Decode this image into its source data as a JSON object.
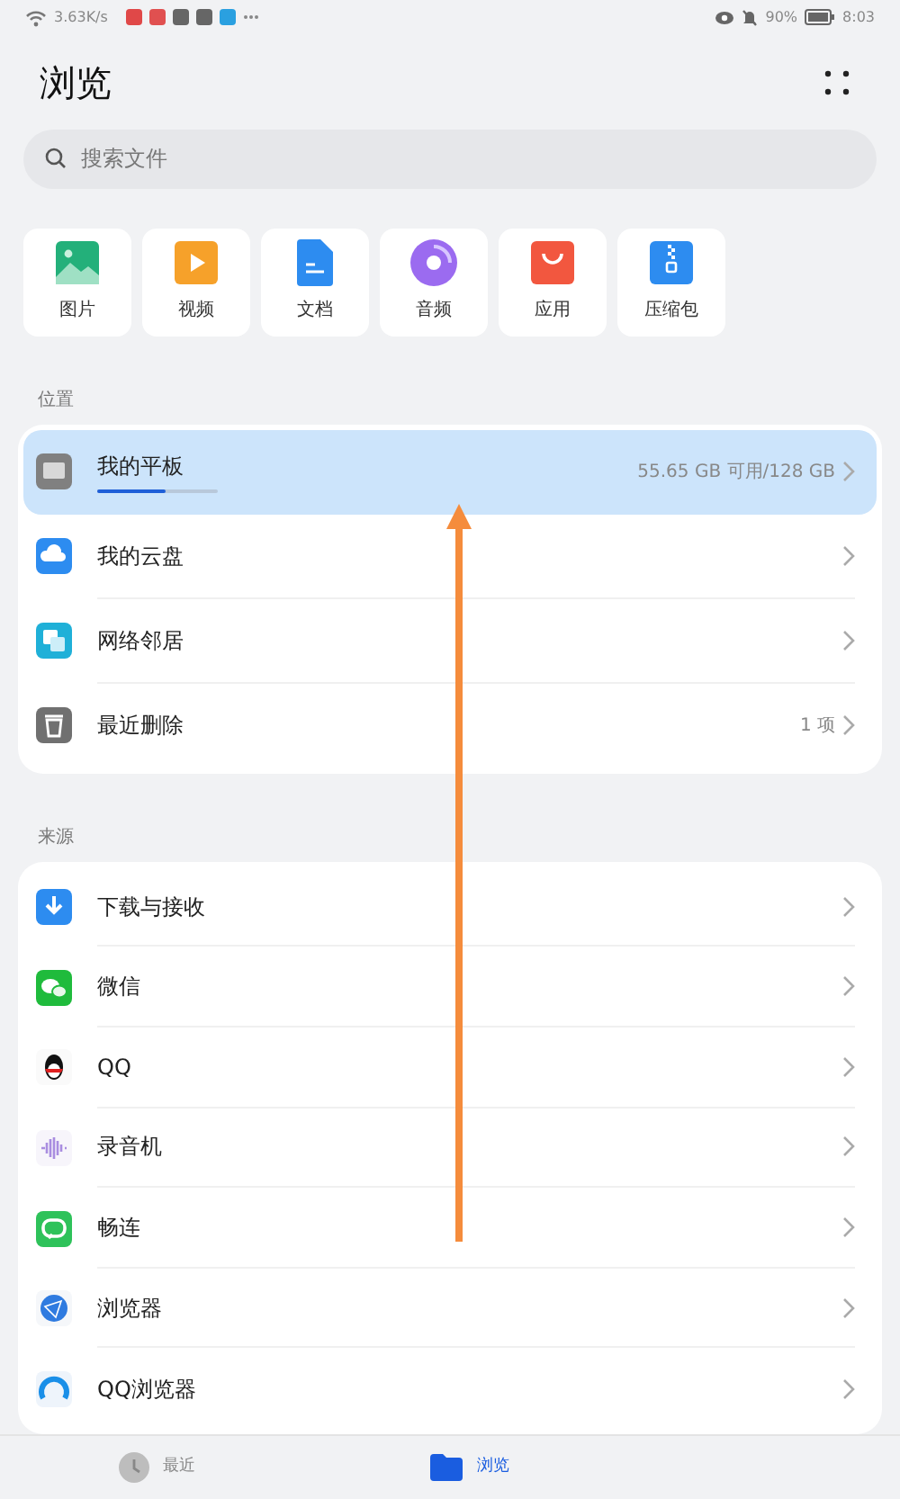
{
  "status_bar": {
    "speed": "3.63K/s",
    "battery": "90%",
    "time": "8:03"
  },
  "title": "浏览",
  "search": {
    "placeholder": "搜索文件"
  },
  "categories": [
    {
      "label": "图片"
    },
    {
      "label": "视频"
    },
    {
      "label": "文档"
    },
    {
      "label": "音频"
    },
    {
      "label": "应用"
    },
    {
      "label": "压缩包"
    }
  ],
  "locations": {
    "heading": "位置",
    "items": [
      {
        "label": "我的平板",
        "detail": "55.65 GB 可用/128 GB",
        "selected": true,
        "level": 0.57
      },
      {
        "label": "我的云盘",
        "selected": false
      },
      {
        "label": "网络邻居",
        "selected": false
      },
      {
        "label": "最近删除",
        "detail": "1 项",
        "selected": false
      }
    ]
  },
  "sources": {
    "heading": "来源",
    "items": [
      {
        "label": "下载与接收"
      },
      {
        "label": "微信"
      },
      {
        "label": "QQ"
      },
      {
        "label": "录音机"
      },
      {
        "label": "畅连"
      },
      {
        "label": "浏览器"
      },
      {
        "label": "QQ浏览器"
      }
    ]
  },
  "bottom_tabs": [
    {
      "label": "最近",
      "selected": false
    },
    {
      "label": "浏览",
      "selected": true
    }
  ]
}
